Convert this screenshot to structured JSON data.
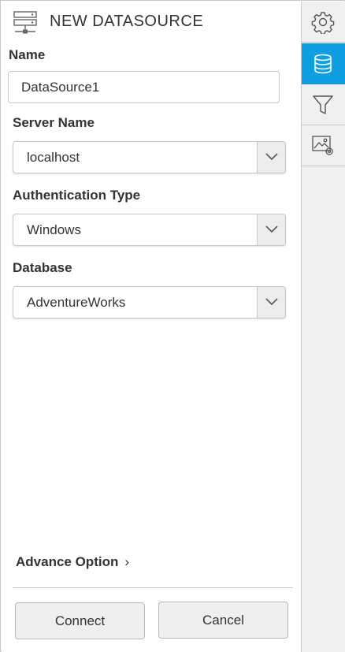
{
  "header": {
    "title": "NEW DATASOURCE",
    "icon": "server-icon"
  },
  "form": {
    "name": {
      "label": "Name",
      "value": "DataSource1"
    },
    "server": {
      "label": "Server Name",
      "value": "localhost"
    },
    "auth": {
      "label": "Authentication Type",
      "value": "Windows"
    },
    "database": {
      "label": "Database",
      "value": "AdventureWorks"
    }
  },
  "advance": {
    "label": "Advance Option",
    "chevron": "›"
  },
  "buttons": {
    "connect": "Connect",
    "cancel": "Cancel"
  },
  "rail": {
    "items": [
      {
        "icon": "gear-icon",
        "active": false
      },
      {
        "icon": "database-icon",
        "active": true
      },
      {
        "icon": "filter-icon",
        "active": false
      },
      {
        "icon": "image-settings-icon",
        "active": false
      }
    ]
  },
  "colors": {
    "accent": "#0f9ee0",
    "border": "#c8c8c8",
    "rail_bg": "#f0f0f0"
  }
}
